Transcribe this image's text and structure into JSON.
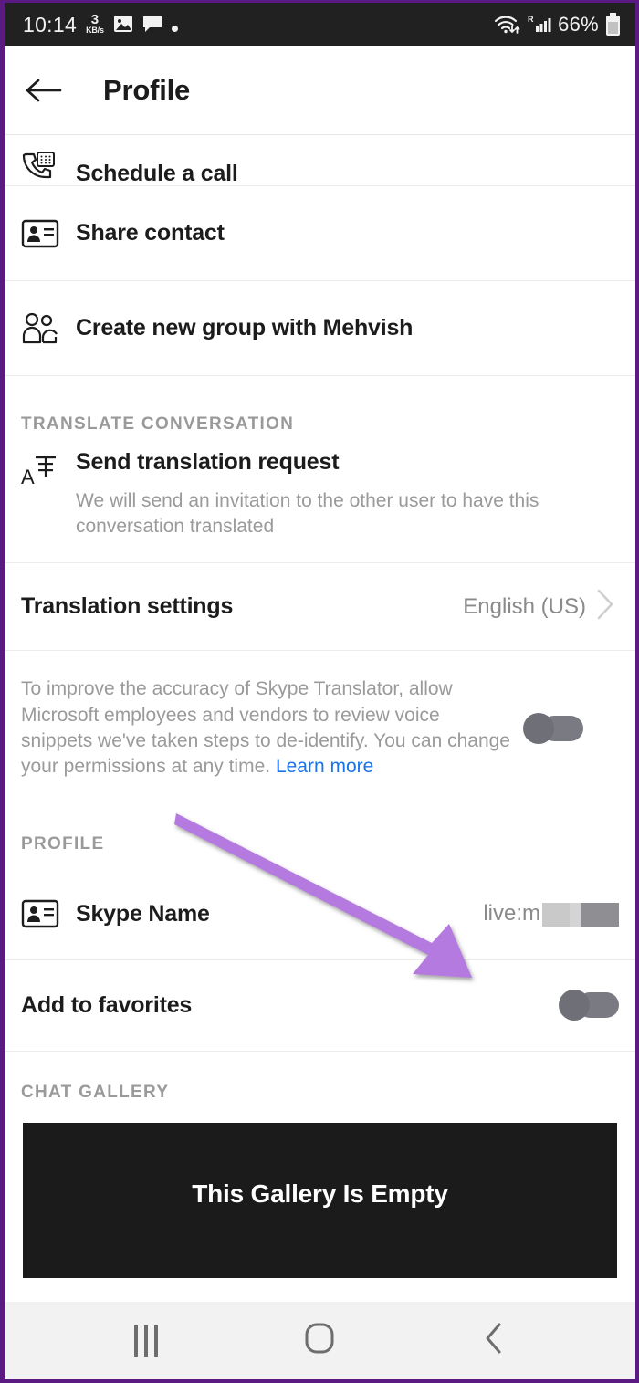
{
  "status_bar": {
    "time": "10:14",
    "network_speed_value": "3",
    "network_speed_unit": "KB/s",
    "icons": [
      "image-icon",
      "chat-bubble-icon",
      "dot-indicator"
    ],
    "wifi_icon": "wifi-updown-icon",
    "signal_icon": "cellular-signal-roaming-icon",
    "roaming_label": "R",
    "battery_percent": "66%",
    "battery_icon": "battery-icon",
    "background_color": "#212121"
  },
  "app_bar": {
    "back_icon": "back-arrow-icon",
    "title": "Profile"
  },
  "actions": [
    {
      "id": "schedule-a-call",
      "icon": "phone-schedule-icon",
      "label": "Schedule a call"
    },
    {
      "id": "share-contact",
      "icon": "contact-card-icon",
      "label": "Share contact"
    },
    {
      "id": "create-new-group",
      "icon": "people-group-icon",
      "label": "Create new group with Mehvish"
    }
  ],
  "translate_section": {
    "heading": "TRANSLATE CONVERSATION",
    "send_request": {
      "icon": "translate-icon",
      "title": "Send translation request",
      "subtitle": "We will send an invitation to the other user to have this conversation translated"
    },
    "translation_settings": {
      "label": "Translation settings",
      "value": "English (US)",
      "chevron_icon": "chevron-right-icon"
    },
    "consent": {
      "text_before_link": "To improve the accuracy of Skype Translator, allow Microsoft employees and vendors to review voice snippets we've taken steps to de-identify. You can change your permissions at any time. ",
      "link_label": "Learn more",
      "link_color": "#1a73e8",
      "toggle_state": "off"
    }
  },
  "profile_section": {
    "heading": "PROFILE",
    "skype_name": {
      "icon": "contact-card-icon",
      "label": "Skype Name",
      "value": "live:m",
      "value_redacted": true
    },
    "add_to_favorites": {
      "label": "Add to favorites",
      "toggle_state": "off"
    }
  },
  "chat_gallery": {
    "heading": "CHAT GALLERY",
    "empty_title": "This Gallery Is Empty",
    "empty_subtitle": "",
    "background_color": "#1b1b1b"
  },
  "annotation": {
    "type": "arrow",
    "color": "#b57ae0",
    "points_to": "skype-name-value"
  },
  "nav_bar": {
    "recents_icon": "recents-icon",
    "home_icon": "home-icon",
    "back_icon": "nav-back-icon",
    "background_color": "#f2f2f2"
  }
}
